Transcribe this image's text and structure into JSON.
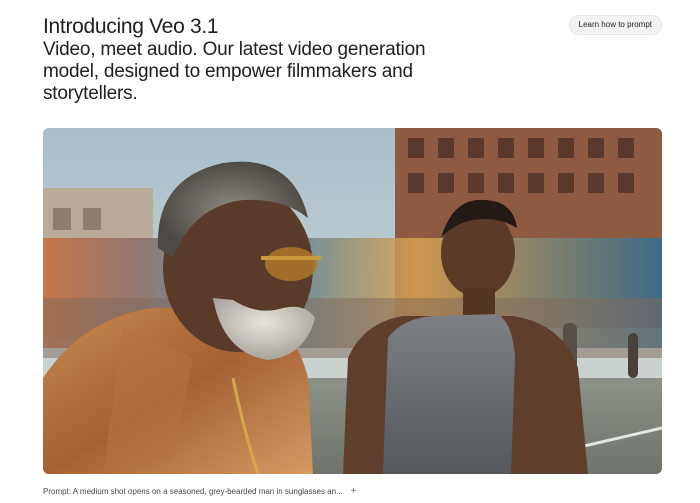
{
  "header": {
    "title": "Introducing Veo 3.1",
    "subtitle": "Video, meet audio. Our latest video generation model, designed to empower filmmakers and storytellers."
  },
  "actions": {
    "learn_label": "Learn how to prompt"
  },
  "video": {
    "alt": "Still frame: older grey-bearded man in sunglasses and patterned shirt beside a younger man in a grey tank top on a city basketball court"
  },
  "caption": {
    "text": "Prompt: A medium shot opens on a seasoned, grey-bearded man in sunglasses an...",
    "expand_symbol": "+"
  },
  "colors": {
    "text": "#1f1f1f",
    "button_bg": "#f1f3f4",
    "caption": "#444746"
  }
}
